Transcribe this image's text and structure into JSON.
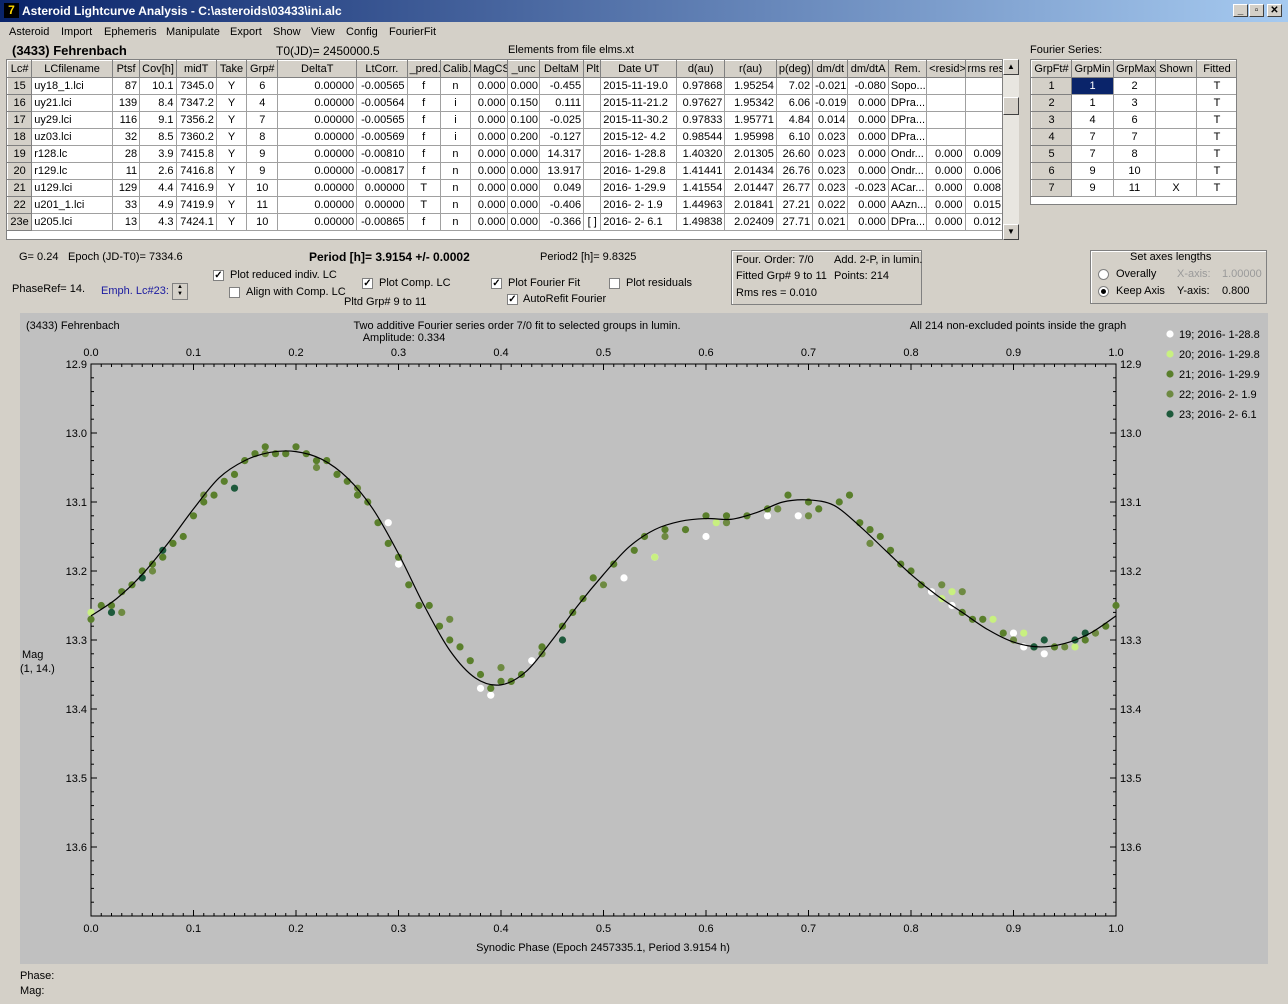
{
  "window": {
    "title": "Asteroid Lightcurve Analysis - C:\\asteroids\\03433\\ini.alc",
    "icon_glyph": "7"
  },
  "menu": [
    "Asteroid",
    "Import",
    "Ephemeris",
    "Manipulate",
    "Export",
    "Show",
    "View",
    "Config",
    "FourierFit"
  ],
  "header": {
    "asteroid": "(3433) Fehrenbach",
    "t0": "T0(JD)= 2450000.5",
    "elements": "Elements from file elms.xt",
    "fourier_title": "Fourier Series:"
  },
  "lc_table": {
    "columns": [
      "Lc#",
      "LCfilename",
      "Ptsf",
      "Cov[h]",
      "midT",
      "Take",
      "Grp#",
      "DeltaT",
      "LtCorr.",
      "_pred.",
      "Calib.",
      "MagCS",
      "_unc",
      "DeltaM",
      "Plt",
      "Date UT",
      "d(au)",
      "r(au)",
      "p(deg)",
      "dm/dt",
      "dm/dtA",
      "Rem.",
      "<resid>",
      "rms res"
    ],
    "rows": [
      [
        "15",
        "uy18_1.lci",
        "87",
        "10.1",
        "7345.0",
        "Y",
        "6",
        "0.00000",
        "-0.00565",
        "f",
        "n",
        "0.000",
        "0.000",
        "-0.455",
        "",
        "2015-11-19.0",
        "0.97868",
        "1.95254",
        "7.02",
        "-0.021",
        "-0.080",
        "Sopo...",
        "",
        ""
      ],
      [
        "16",
        "uy21.lci",
        "139",
        "8.4",
        "7347.2",
        "Y",
        "4",
        "0.00000",
        "-0.00564",
        "f",
        "i",
        "0.000",
        "0.150",
        "0.111",
        "",
        "2015-11-21.2",
        "0.97627",
        "1.95342",
        "6.06",
        "-0.019",
        "0.000",
        "DPra...",
        "",
        ""
      ],
      [
        "17",
        "uy29.lci",
        "116",
        "9.1",
        "7356.2",
        "Y",
        "7",
        "0.00000",
        "-0.00565",
        "f",
        "i",
        "0.000",
        "0.100",
        "-0.025",
        "",
        "2015-11-30.2",
        "0.97833",
        "1.95771",
        "4.84",
        "0.014",
        "0.000",
        "DPra...",
        "",
        ""
      ],
      [
        "18",
        "uz03.lci",
        "32",
        "8.5",
        "7360.2",
        "Y",
        "8",
        "0.00000",
        "-0.00569",
        "f",
        "i",
        "0.000",
        "0.200",
        "-0.127",
        "",
        "2015-12- 4.2",
        "0.98544",
        "1.95998",
        "6.10",
        "0.023",
        "0.000",
        "DPra...",
        "",
        ""
      ],
      [
        "19",
        "r128.lc",
        "28",
        "3.9",
        "7415.8",
        "Y",
        "9",
        "0.00000",
        "-0.00810",
        "f",
        "n",
        "0.000",
        "0.000",
        "14.317",
        "",
        "2016- 1-28.8",
        "1.40320",
        "2.01305",
        "26.60",
        "0.023",
        "0.000",
        "Ondr...",
        "0.000",
        "0.009"
      ],
      [
        "20",
        "r129.lc",
        "11",
        "2.6",
        "7416.8",
        "Y",
        "9",
        "0.00000",
        "-0.00817",
        "f",
        "n",
        "0.000",
        "0.000",
        "13.917",
        "",
        "2016- 1-29.8",
        "1.41441",
        "2.01434",
        "26.76",
        "0.023",
        "0.000",
        "Ondr...",
        "0.000",
        "0.006"
      ],
      [
        "21",
        "u129.lci",
        "129",
        "4.4",
        "7416.9",
        "Y",
        "10",
        "0.00000",
        "0.00000",
        "T",
        "n",
        "0.000",
        "0.000",
        "0.049",
        "",
        "2016- 1-29.9",
        "1.41554",
        "2.01447",
        "26.77",
        "0.023",
        "-0.023",
        "ACar...",
        "0.000",
        "0.008"
      ],
      [
        "22",
        "u201_1.lci",
        "33",
        "4.9",
        "7419.9",
        "Y",
        "11",
        "0.00000",
        "0.00000",
        "T",
        "n",
        "0.000",
        "0.000",
        "-0.406",
        "",
        "2016- 2- 1.9",
        "1.44963",
        "2.01841",
        "27.21",
        "0.022",
        "0.000",
        "AAzn...",
        "0.000",
        "0.015"
      ],
      [
        "23e",
        "u205.lci",
        "13",
        "4.3",
        "7424.1",
        "Y",
        "10",
        "0.00000",
        "-0.00865",
        "f",
        "n",
        "0.000",
        "0.000",
        "-0.366",
        "[ ]",
        "2016- 2- 6.1",
        "1.49838",
        "2.02409",
        "27.71",
        "0.021",
        "0.000",
        "DPra...",
        "0.000",
        "0.012"
      ]
    ]
  },
  "fourier_table": {
    "columns": [
      "GrpFt#",
      "GrpMin",
      "GrpMax",
      "Shown",
      "Fitted"
    ],
    "rows": [
      [
        "1",
        "1",
        "2",
        "",
        "T"
      ],
      [
        "2",
        "1",
        "3",
        "",
        "T"
      ],
      [
        "3",
        "4",
        "6",
        "",
        "T"
      ],
      [
        "4",
        "7",
        "7",
        "",
        "T"
      ],
      [
        "5",
        "7",
        "8",
        "",
        "T"
      ],
      [
        "6",
        "9",
        "10",
        "",
        "T"
      ],
      [
        "7",
        "9",
        "11",
        "X",
        "T"
      ]
    ]
  },
  "controls": {
    "g": "G= 0.24",
    "epoch": "Epoch (JD-T0)= 7334.6",
    "period": "Period [h]= 3.9154 +/- 0.0002",
    "period2": "Period2 [h]= 9.8325",
    "phaseref": "PhaseRef= 14.",
    "emph": "Emph. Lc#23:",
    "plot_reduced": "Plot reduced indiv. LC",
    "align_comp": "Align with Comp. LC",
    "plot_comp": "Plot Comp. LC",
    "pltd_grp": "Pltd Grp#  9   to   11",
    "plot_fourier": "Plot Fourier Fit",
    "autorefit": "AutoRefit Fourier",
    "plot_residuals": "Plot residuals",
    "fit_info": {
      "order": "Four. Order:  7/0",
      "add": "Add. 2-P, in lumin.",
      "fitted": "Fitted Grp# 9 to 11",
      "points": "Points: 214",
      "rms": "Rms res     = 0.010"
    },
    "axes": {
      "title": "Set axes lengths",
      "overally": "Overally",
      "keep_axis": "Keep Axis",
      "x_label": "X-axis:",
      "x_value": "1.00000",
      "y_label": "Y-axis:",
      "y_value": "0.800"
    }
  },
  "plot": {
    "left_title": "(3433) Fehrenbach",
    "center_title": "Two additive Fourier series order 7/0 fit to selected groups in lumin.",
    "amplitude": "Amplitude: 0.334",
    "right_title": "All 214 non-excluded points inside the graph",
    "xlabel": "Synodic Phase (Epoch 2457335.1, Period 3.9154 h)",
    "ylabel": "Mag",
    "ylabel2": "(1, 14.)",
    "footer_phase": "Phase:",
    "footer_mag": "Mag:"
  },
  "chart_data": {
    "type": "scatter",
    "xlim": [
      0.0,
      1.0
    ],
    "ylim": [
      13.7,
      12.9
    ],
    "y_inverted": true,
    "x_ticks": [
      "0.0",
      "0.1",
      "0.2",
      "0.3",
      "0.4",
      "0.5",
      "0.6",
      "0.7",
      "0.8",
      "0.9",
      "1.0"
    ],
    "y_ticks": [
      "12.9",
      "13.0",
      "13.1",
      "13.2",
      "13.3",
      "13.4",
      "13.5",
      "13.6"
    ],
    "fit_curve": {
      "x": [
        0.0,
        0.025,
        0.05,
        0.075,
        0.1,
        0.125,
        0.15,
        0.175,
        0.2,
        0.225,
        0.25,
        0.275,
        0.3,
        0.325,
        0.35,
        0.375,
        0.4,
        0.425,
        0.45,
        0.475,
        0.5,
        0.525,
        0.55,
        0.575,
        0.6,
        0.625,
        0.65,
        0.675,
        0.7,
        0.725,
        0.75,
        0.775,
        0.8,
        0.825,
        0.85,
        0.875,
        0.9,
        0.925,
        0.95,
        0.975,
        1.0
      ],
      "y": [
        13.265,
        13.24,
        13.205,
        13.16,
        13.11,
        13.065,
        13.04,
        13.028,
        13.027,
        13.038,
        13.065,
        13.11,
        13.175,
        13.25,
        13.315,
        13.355,
        13.365,
        13.345,
        13.3,
        13.25,
        13.205,
        13.165,
        13.14,
        13.128,
        13.124,
        13.125,
        13.115,
        13.1,
        13.097,
        13.105,
        13.135,
        13.17,
        13.205,
        13.235,
        13.26,
        13.285,
        13.303,
        13.31,
        13.305,
        13.29,
        13.265
      ]
    },
    "series": [
      {
        "name": "19; 2016- 1-28.8",
        "color": "#ffffff",
        "x": [
          0.5,
          0.52,
          0.55,
          0.6,
          0.66,
          0.69,
          0.82,
          0.84,
          0.9,
          0.91,
          0.93,
          0.95,
          0.29,
          0.3,
          0.38,
          0.39,
          0.43
        ],
        "y": [
          13.22,
          13.21,
          13.18,
          13.15,
          13.12,
          13.12,
          13.23,
          13.25,
          13.29,
          13.31,
          13.32,
          13.31,
          13.13,
          13.19,
          13.37,
          13.38,
          13.33
        ]
      },
      {
        "name": "20; 2016- 1-29.8",
        "color": "#c8f080",
        "x": [
          0.55,
          0.61,
          0.83,
          0.84,
          0.88,
          0.91,
          0.96,
          0.98,
          0.0
        ],
        "y": [
          13.18,
          13.13,
          13.24,
          13.23,
          13.27,
          13.29,
          13.31,
          13.29,
          13.26
        ]
      },
      {
        "name": "21; 2016- 1-29.9",
        "color": "#5a7f2c",
        "x": [
          0.0,
          0.01,
          0.02,
          0.03,
          0.04,
          0.05,
          0.06,
          0.07,
          0.08,
          0.09,
          0.1,
          0.11,
          0.12,
          0.13,
          0.14,
          0.15,
          0.16,
          0.17,
          0.18,
          0.19,
          0.2,
          0.21,
          0.22,
          0.23,
          0.24,
          0.25,
          0.26,
          0.27,
          0.28,
          0.29,
          0.3,
          0.31,
          0.32,
          0.33,
          0.34,
          0.35,
          0.36,
          0.37,
          0.38,
          0.39,
          0.4,
          0.41,
          0.42,
          0.44,
          0.46,
          0.47,
          0.48,
          0.49,
          0.51,
          0.53,
          0.54,
          0.56,
          0.58,
          0.6,
          0.62,
          0.64,
          0.66,
          0.68,
          0.7,
          0.71,
          0.73,
          0.74,
          0.75,
          0.76,
          0.77,
          0.78,
          0.79,
          0.8,
          0.81,
          0.85,
          0.86,
          0.87,
          0.89,
          0.92,
          0.94,
          0.97,
          0.99,
          1.0
        ],
        "y": [
          13.27,
          13.25,
          13.25,
          13.23,
          13.22,
          13.2,
          13.19,
          13.18,
          13.16,
          13.15,
          13.12,
          13.1,
          13.09,
          13.07,
          13.06,
          13.04,
          13.03,
          13.02,
          13.03,
          13.03,
          13.02,
          13.03,
          13.04,
          13.04,
          13.06,
          13.07,
          13.09,
          13.1,
          13.13,
          13.16,
          13.18,
          13.22,
          13.25,
          13.25,
          13.28,
          13.3,
          13.31,
          13.33,
          13.35,
          13.37,
          13.36,
          13.36,
          13.35,
          13.31,
          13.28,
          13.26,
          13.24,
          13.21,
          13.19,
          13.17,
          13.15,
          13.14,
          13.14,
          13.12,
          13.12,
          13.12,
          13.11,
          13.09,
          13.1,
          13.11,
          13.1,
          13.09,
          13.13,
          13.14,
          13.15,
          13.17,
          13.19,
          13.2,
          13.22,
          13.26,
          13.27,
          13.27,
          13.29,
          13.31,
          13.31,
          13.3,
          13.28,
          13.25
        ]
      },
      {
        "name": "22; 2016- 2- 1.9",
        "color": "#6e8a42",
        "x": [
          0.03,
          0.06,
          0.11,
          0.17,
          0.22,
          0.26,
          0.35,
          0.4,
          0.44,
          0.5,
          0.56,
          0.62,
          0.67,
          0.7,
          0.76,
          0.83,
          0.85,
          0.9,
          0.95,
          0.98
        ],
        "y": [
          13.26,
          13.2,
          13.09,
          13.03,
          13.05,
          13.08,
          13.27,
          13.34,
          13.32,
          13.22,
          13.15,
          13.13,
          13.11,
          13.12,
          13.16,
          13.22,
          13.23,
          13.3,
          13.31,
          13.29
        ]
      },
      {
        "name": "23; 2016- 2- 6.1",
        "color": "#1e5a3c",
        "x": [
          0.02,
          0.05,
          0.07,
          0.14,
          0.46,
          0.92,
          0.93,
          0.96,
          0.97
        ],
        "y": [
          13.26,
          13.21,
          13.17,
          13.08,
          13.3,
          13.31,
          13.3,
          13.3,
          13.29
        ]
      }
    ]
  }
}
